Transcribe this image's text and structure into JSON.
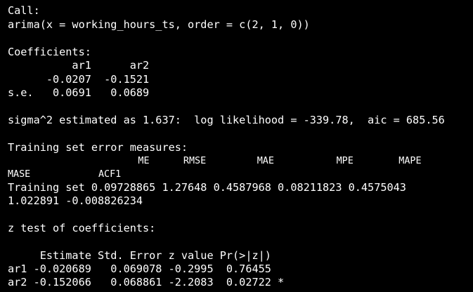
{
  "console": {
    "call_header": "Call:",
    "call_expr": "arima(x = working_hours_ts, order = c(2, 1, 0))",
    "coef_header": "Coefficients:",
    "coef_names": "          ar1      ar2",
    "coef_values": "      -0.0207  -0.1521",
    "coef_se": "s.e.   0.0691   0.0689",
    "sigma_line": "sigma^2 estimated as 1.637:  log likelihood = -339.78,  aic = 685.56",
    "err_header": "Training set error measures:",
    "err_cols_1": "                       ME      RMSE         MAE           MPE        MAPE",
    "err_cols_2": "MASE            ACF1",
    "err_row_1": "Training set 0.09728865 1.27648 0.4587968 0.08211823 0.4575043",
    "err_row_2": "1.022891 -0.008826234",
    "ztest_header": "z test of coefficients:",
    "ztest_cols": "     Estimate Std. Error z value Pr(>|z|)",
    "ztest_ar1": "ar1 -0.020689   0.069078 -0.2995  0.76455",
    "ztest_ar2": "ar2 -0.152066   0.068861 -2.2083  0.02722 *"
  },
  "colors": {
    "background": "#000000",
    "text": "#ffffff"
  }
}
